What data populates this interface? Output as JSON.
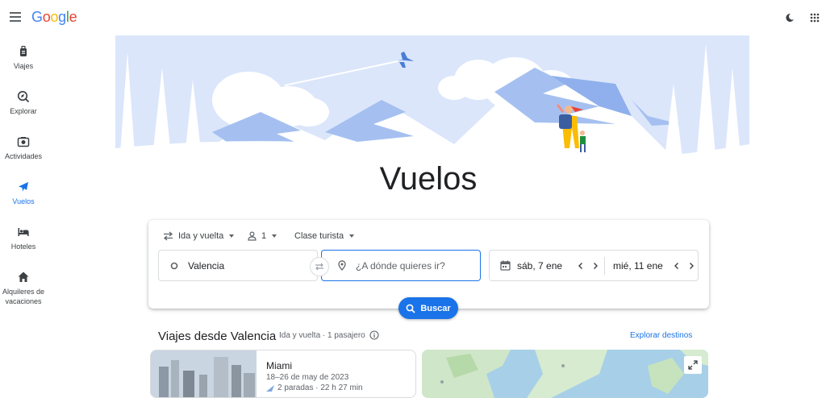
{
  "header": {
    "logo_letters": [
      "G",
      "o",
      "o",
      "g",
      "l",
      "e"
    ],
    "menu_icon": "hamburger-menu-icon",
    "theme_icon": "moon-icon",
    "apps_icon": "apps-grid-icon"
  },
  "sidebar": {
    "items": [
      {
        "label": "Viajes",
        "icon": "luggage-icon"
      },
      {
        "label": "Explorar",
        "icon": "explore-icon"
      },
      {
        "label": "Actividades",
        "icon": "camera-icon"
      },
      {
        "label": "Vuelos",
        "icon": "airplane-icon",
        "active": true
      },
      {
        "label": "Hoteles",
        "icon": "bed-icon"
      },
      {
        "label": "Alquileres de vacaciones",
        "icon": "house-icon"
      }
    ]
  },
  "main": {
    "title": "Vuelos"
  },
  "search": {
    "trip_type": "Ida y vuelta",
    "passengers": "1",
    "cabin_class": "Clase turista",
    "origin": "Valencia",
    "destination_placeholder": "¿A dónde quieres ir?",
    "depart_date": "sáb, 7 ene",
    "return_date": "mié, 11 ene",
    "search_button": "Buscar"
  },
  "trips": {
    "title": "Viajes desde Valencia",
    "subtitle": "Ida y vuelta · 1 pasajero",
    "explore_link": "Explorar destinos",
    "cards": [
      {
        "city": "Miami",
        "dates": "18–26 de may de 2023",
        "stops": "2 paradas · 22 h 27 min"
      }
    ]
  },
  "colors": {
    "accent": "#1a73e8",
    "text": "#202124",
    "muted": "#5f6368",
    "border": "#dadce0",
    "hero_sky": "#dbe6fb"
  }
}
